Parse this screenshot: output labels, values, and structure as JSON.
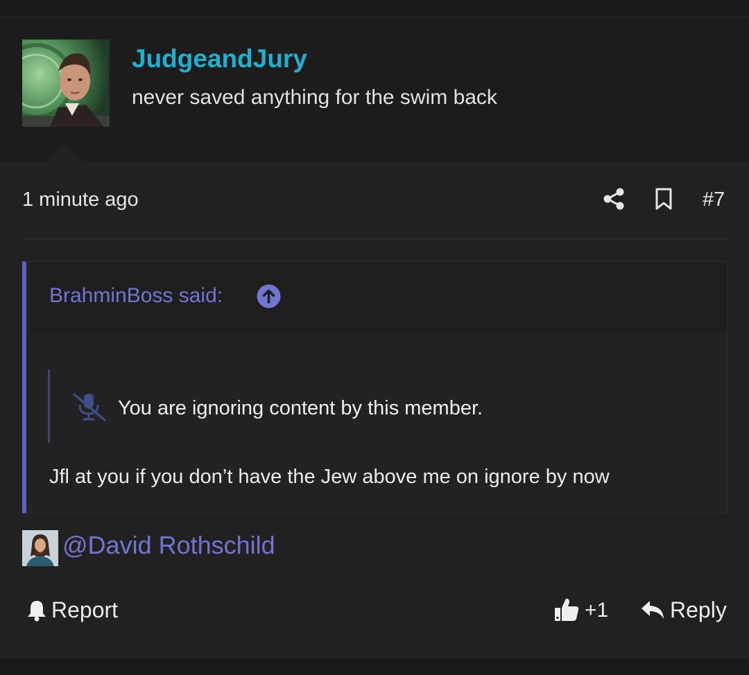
{
  "post": {
    "author": {
      "username": "JudgeandJury",
      "user_title": "never saved anything for the swim back"
    },
    "time": "1 minute ago",
    "number": "#7",
    "quote": {
      "author_label": "BrahminBoss said:",
      "ignored_notice": "You are ignoring content by this member.",
      "text": "Jfl at you if you don’t have the Jew above me on ignore by now"
    },
    "mention": "@David Rothschild",
    "actions": {
      "report_label": "Report",
      "reaction_count": "+1",
      "reply_label": "Reply"
    }
  },
  "colors": {
    "username": "#1eb1cf",
    "link": "#6f76cf",
    "quote_border": "#5b63c4"
  },
  "icons": [
    "share-icon",
    "bookmark-icon",
    "arrow-up-circle-icon",
    "muted-microphone-icon",
    "bell-icon",
    "thumbs-up-icon",
    "reply-arrow-icon"
  ]
}
